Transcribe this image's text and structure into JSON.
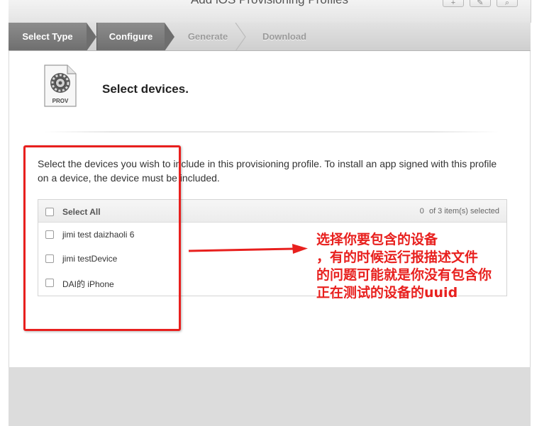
{
  "window": {
    "title": "Add iOS Provisioning Profiles"
  },
  "steps": [
    {
      "label": "Select Type",
      "state": "completed"
    },
    {
      "label": "Configure",
      "state": "active"
    },
    {
      "label": "Generate",
      "state": "pending"
    },
    {
      "label": "Download",
      "state": "pending"
    }
  ],
  "page": {
    "icon_label": "PROV",
    "heading": "Select devices.",
    "description": "Select the devices you wish to include in this provisioning profile. To install an app signed with this profile on a device, the device must be included."
  },
  "device_table": {
    "select_all_label": "Select All",
    "selected_count": "0",
    "count_suffix": "of 3 item(s) selected",
    "devices": [
      {
        "name": "jimi test daizhaoli 6",
        "checked": false
      },
      {
        "name": "jimi testDevice",
        "checked": false
      },
      {
        "name": "DAI的 iPhone",
        "checked": false
      }
    ]
  },
  "annotation": {
    "color": "#e8201e",
    "lines": [
      "选择你要包含的设备",
      "，有的时候运行报描述文件",
      "的问题可能就是你没有包含你",
      "正在测试的设备的uuid"
    ]
  },
  "colors": {
    "active_step": "#7c7c7c",
    "annotation_red": "#e8201e"
  }
}
